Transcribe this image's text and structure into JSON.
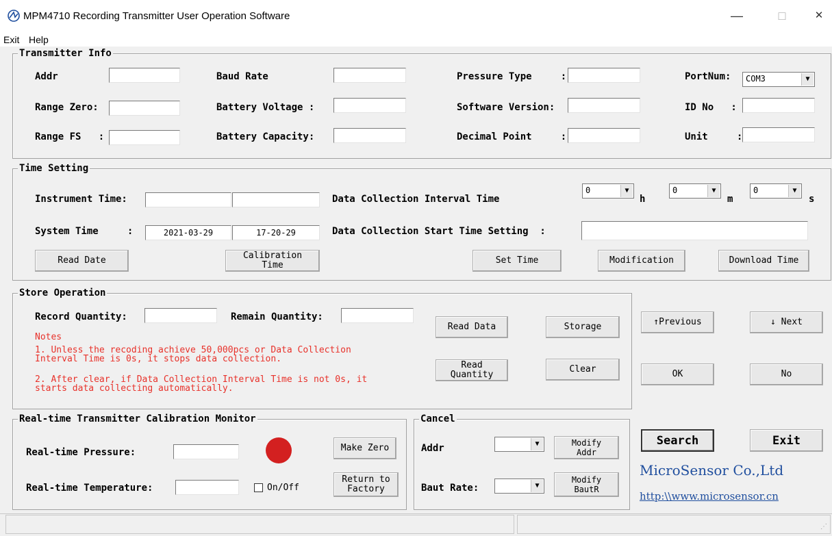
{
  "window": {
    "title": "MPM4710 Recording Transmitter User Operation Software",
    "minimize": "—",
    "maximize": "□",
    "close": "✕"
  },
  "menu": {
    "exit": "Exit",
    "help": "Help"
  },
  "transmitter_info": {
    "legend": "Transmitter Info",
    "addr_label": "Addr         :",
    "range_zero_label": "Range Zero:",
    "range_fs_label": "Range FS   :",
    "baud_rate_label": "Baud Rate           :",
    "battery_voltage_label": "Battery Voltage :",
    "battery_capacity_label": "Battery Capacity:",
    "pressure_type_label": "Pressure Type     :",
    "software_version_label": "Software Version:",
    "decimal_point_label": "Decimal Point     :",
    "portnum_label": "PortNum:",
    "portnum_value": "COM3",
    "id_no_label": "ID No   :",
    "unit_label": "Unit     :"
  },
  "time_setting": {
    "legend": "Time Setting",
    "instrument_time_label": "Instrument Time:",
    "system_time_label": "System Time     :",
    "system_date_value": "2021-03-29",
    "system_time_value": "17-20-29",
    "interval_label": "Data Collection Interval Time",
    "interval_h": "0",
    "interval_m": "0",
    "interval_s": "0",
    "h_unit": "h",
    "m_unit": "m",
    "s_unit": "s",
    "start_time_label": "Data Collection Start Time Setting  :",
    "read_date": "Read Date",
    "calibration_time": "Calibration Time",
    "set_time": "Set Time",
    "modification": "Modification",
    "download_time": "Download Time"
  },
  "store_operation": {
    "legend": "Store Operation",
    "record_quantity_label": "Record Quantity:",
    "remain_quantity_label": "Remain Quantity:",
    "notes_title": "Notes",
    "note1": "1. Unless the recoding achieve 50,000pcs or Data Collection Interval Time is 0s, it stops data collection.",
    "note2": "2. After clear, if Data Collection Interval Time is not 0s, it starts data collecting automatically.",
    "read_data": "Read Data",
    "storage": "Storage",
    "read_quantity": "Read Quantity",
    "clear": "Clear"
  },
  "nav": {
    "previous": "↑Previous",
    "next": "↓ Next",
    "ok": "OK",
    "no": "No"
  },
  "calibration_monitor": {
    "legend": "Real-time Transmitter Calibration Monitor",
    "pressure_label": "Real-time Pressure:",
    "temperature_label": "Real-time Temperature:",
    "onoff_label": "On/Off",
    "make_zero": "Make Zero",
    "return_factory": "Return to Factory",
    "indicator_color": "#d32020"
  },
  "cancel": {
    "legend": "Cancel",
    "addr_label": "Addr",
    "baut_rate_label": "Baut Rate:",
    "modify_addr": "Modify Addr",
    "modify_bautr": "Modify BautR"
  },
  "footer": {
    "search": "Search",
    "exit": "Exit",
    "company": "MicroSensor Co.,Ltd",
    "url": "http:\\\\www.microsensor.cn",
    "company_color": "#1f4e9e"
  }
}
